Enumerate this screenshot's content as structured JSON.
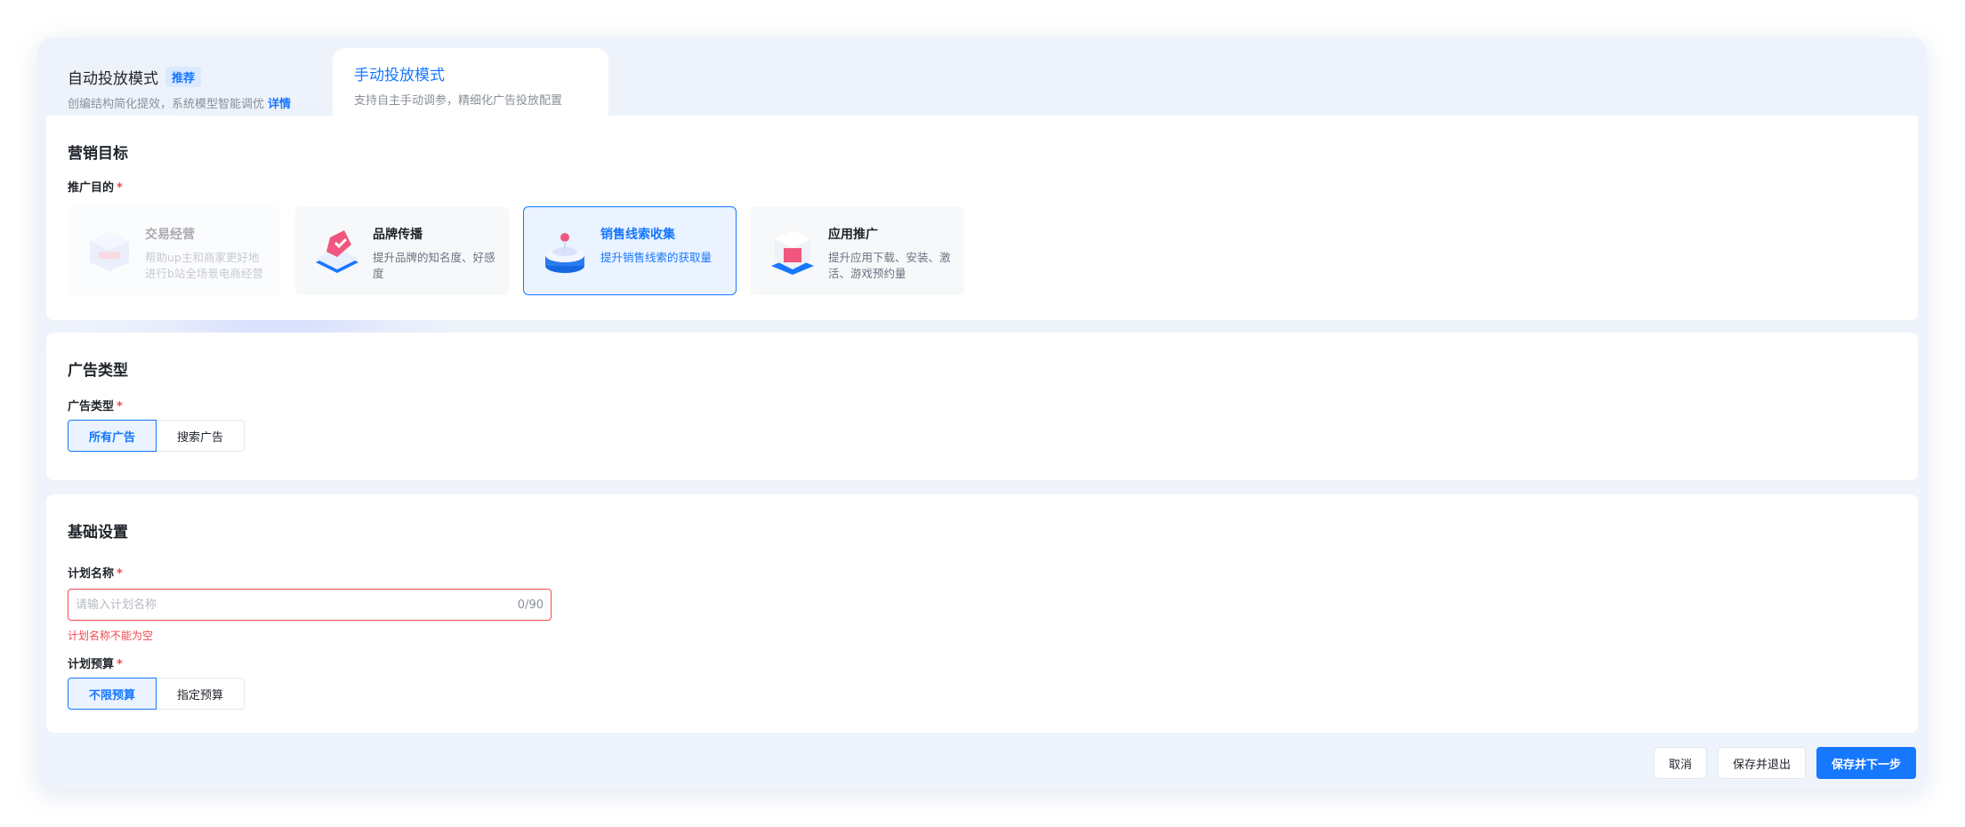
{
  "tabs": {
    "auto": {
      "title": "自动投放模式",
      "badge": "推荐",
      "subtitle": "创编结构简化提效，系统模型智能调优",
      "link": "详情"
    },
    "manual": {
      "title": "手动投放模式",
      "subtitle": "支持自主手动调参，精细化广告投放配置"
    }
  },
  "marketing": {
    "title": "营销目标",
    "purpose_label": "推广目的",
    "cards": [
      {
        "title": "交易经营",
        "desc": "帮助up主和商家更好地进行b站全场景电商经营",
        "state": "disabled",
        "icon": "box-icon"
      },
      {
        "title": "品牌传播",
        "desc": "提升品牌的知名度、好感度",
        "state": "normal",
        "icon": "heart-tag-icon"
      },
      {
        "title": "销售线索收集",
        "desc": "提升销售线索的获取量",
        "state": "selected",
        "icon": "cylinder-icon"
      },
      {
        "title": "应用推广",
        "desc": "提升应用下载、安装、激活、游戏预约量",
        "state": "normal",
        "icon": "app-cube-icon"
      }
    ]
  },
  "ad_type": {
    "title": "广告类型",
    "label": "广告类型",
    "options": [
      "所有广告",
      "搜索广告"
    ],
    "selected": "所有广告"
  },
  "basic": {
    "title": "基础设置",
    "name_label": "计划名称",
    "name_placeholder": "请输入计划名称",
    "name_value": "",
    "name_counter": "0/90",
    "name_error": "计划名称不能为空",
    "budget_label": "计划预算",
    "budget_options": [
      "不限预算",
      "指定预算"
    ],
    "budget_selected": "不限预算"
  },
  "footer": {
    "cancel": "取消",
    "save_exit": "保存并退出",
    "save_next": "保存并下一步"
  },
  "colors": {
    "primary": "#1677ff",
    "error": "#f5484d"
  },
  "required_mark": "*"
}
